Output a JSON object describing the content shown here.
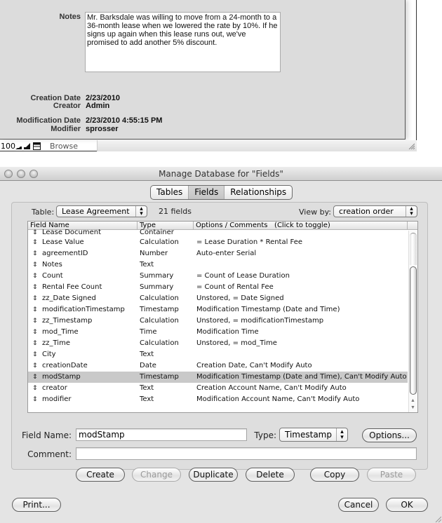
{
  "browse_window": {
    "notes": {
      "label": "Notes",
      "value": "Mr. Barksdale was willing to move from a 24-month to a 36-month lease when we lowered the rate by 10%. If he signs up again when this lease runs out, we've promised to add another 5% discount."
    },
    "fields": [
      {
        "label": "Creation Date",
        "value": "2/23/2010"
      },
      {
        "label": "Creator",
        "value": "Admin"
      },
      {
        "label": "Modification Date",
        "value": "2/23/2010 4:55:15 PM"
      },
      {
        "label": "Modifier",
        "value": "sprosser"
      }
    ],
    "status_bar": {
      "zoom": "100",
      "mode": "Browse",
      "icons": [
        "zoom-out-icon",
        "zoom-in-icon",
        "status-toolbar-toggle-icon"
      ]
    }
  },
  "dialog": {
    "title": "Manage Database for \"Fields\"",
    "tabs": [
      {
        "label": "Tables",
        "active": false
      },
      {
        "label": "Fields",
        "active": true
      },
      {
        "label": "Relationships",
        "active": false
      }
    ],
    "table_label": "Table:",
    "table_selected": "Lease Agreement",
    "field_count": "21 fields",
    "view_by_label": "View by:",
    "view_by_selected": "creation order",
    "columns": [
      "Field Name",
      "Type",
      "Options / Comments   (Click to toggle)"
    ],
    "rows": [
      {
        "name": "Lease Document",
        "type": "Container",
        "options": ""
      },
      {
        "name": "Lease Value",
        "type": "Calculation",
        "options": "= Lease Duration * Rental Fee"
      },
      {
        "name": "agreementID",
        "type": "Number",
        "options": "Auto-enter Serial"
      },
      {
        "name": "Notes",
        "type": "Text",
        "options": ""
      },
      {
        "name": "Count",
        "type": "Summary",
        "options": "= Count of Lease Duration"
      },
      {
        "name": "Rental Fee Count",
        "type": "Summary",
        "options": "= Count of Rental Fee"
      },
      {
        "name": "zz_Date Signed",
        "type": "Calculation",
        "options": "Unstored, = Date Signed"
      },
      {
        "name": "modificationTimestamp",
        "type": "Timestamp",
        "options": "Modification Timestamp (Date and Time)"
      },
      {
        "name": "zz_Timestamp",
        "type": "Calculation",
        "options": "Unstored, = modificationTimestamp"
      },
      {
        "name": "mod_Time",
        "type": "Time",
        "options": "Modification Time"
      },
      {
        "name": "zz_Time",
        "type": "Calculation",
        "options": "Unstored, = mod_Time"
      },
      {
        "name": "City",
        "type": "Text",
        "options": ""
      },
      {
        "name": "creationDate",
        "type": "Date",
        "options": "Creation Date, Can't Modify Auto"
      },
      {
        "name": "modStamp",
        "type": "Timestamp",
        "options": "Modification Timestamp (Date and Time), Can't Modify Auto",
        "selected": true
      },
      {
        "name": "creator",
        "type": "Text",
        "options": "Creation Account Name, Can't Modify Auto"
      },
      {
        "name": "modifier",
        "type": "Text",
        "options": "Modification Account Name, Can't Modify Auto"
      }
    ],
    "row_handle_glyph": "⇕",
    "field_name_label": "Field Name:",
    "field_name_value": "modStamp",
    "type_label": "Type:",
    "type_selected": "Timestamp",
    "options_button": "Options...",
    "comment_label": "Comment:",
    "comment_value": "",
    "buttons": {
      "create": "Create",
      "change": "Change",
      "duplicate": "Duplicate",
      "delete": "Delete",
      "copy": "Copy",
      "paste": "Paste",
      "print": "Print...",
      "cancel": "Cancel",
      "ok": "OK"
    }
  }
}
